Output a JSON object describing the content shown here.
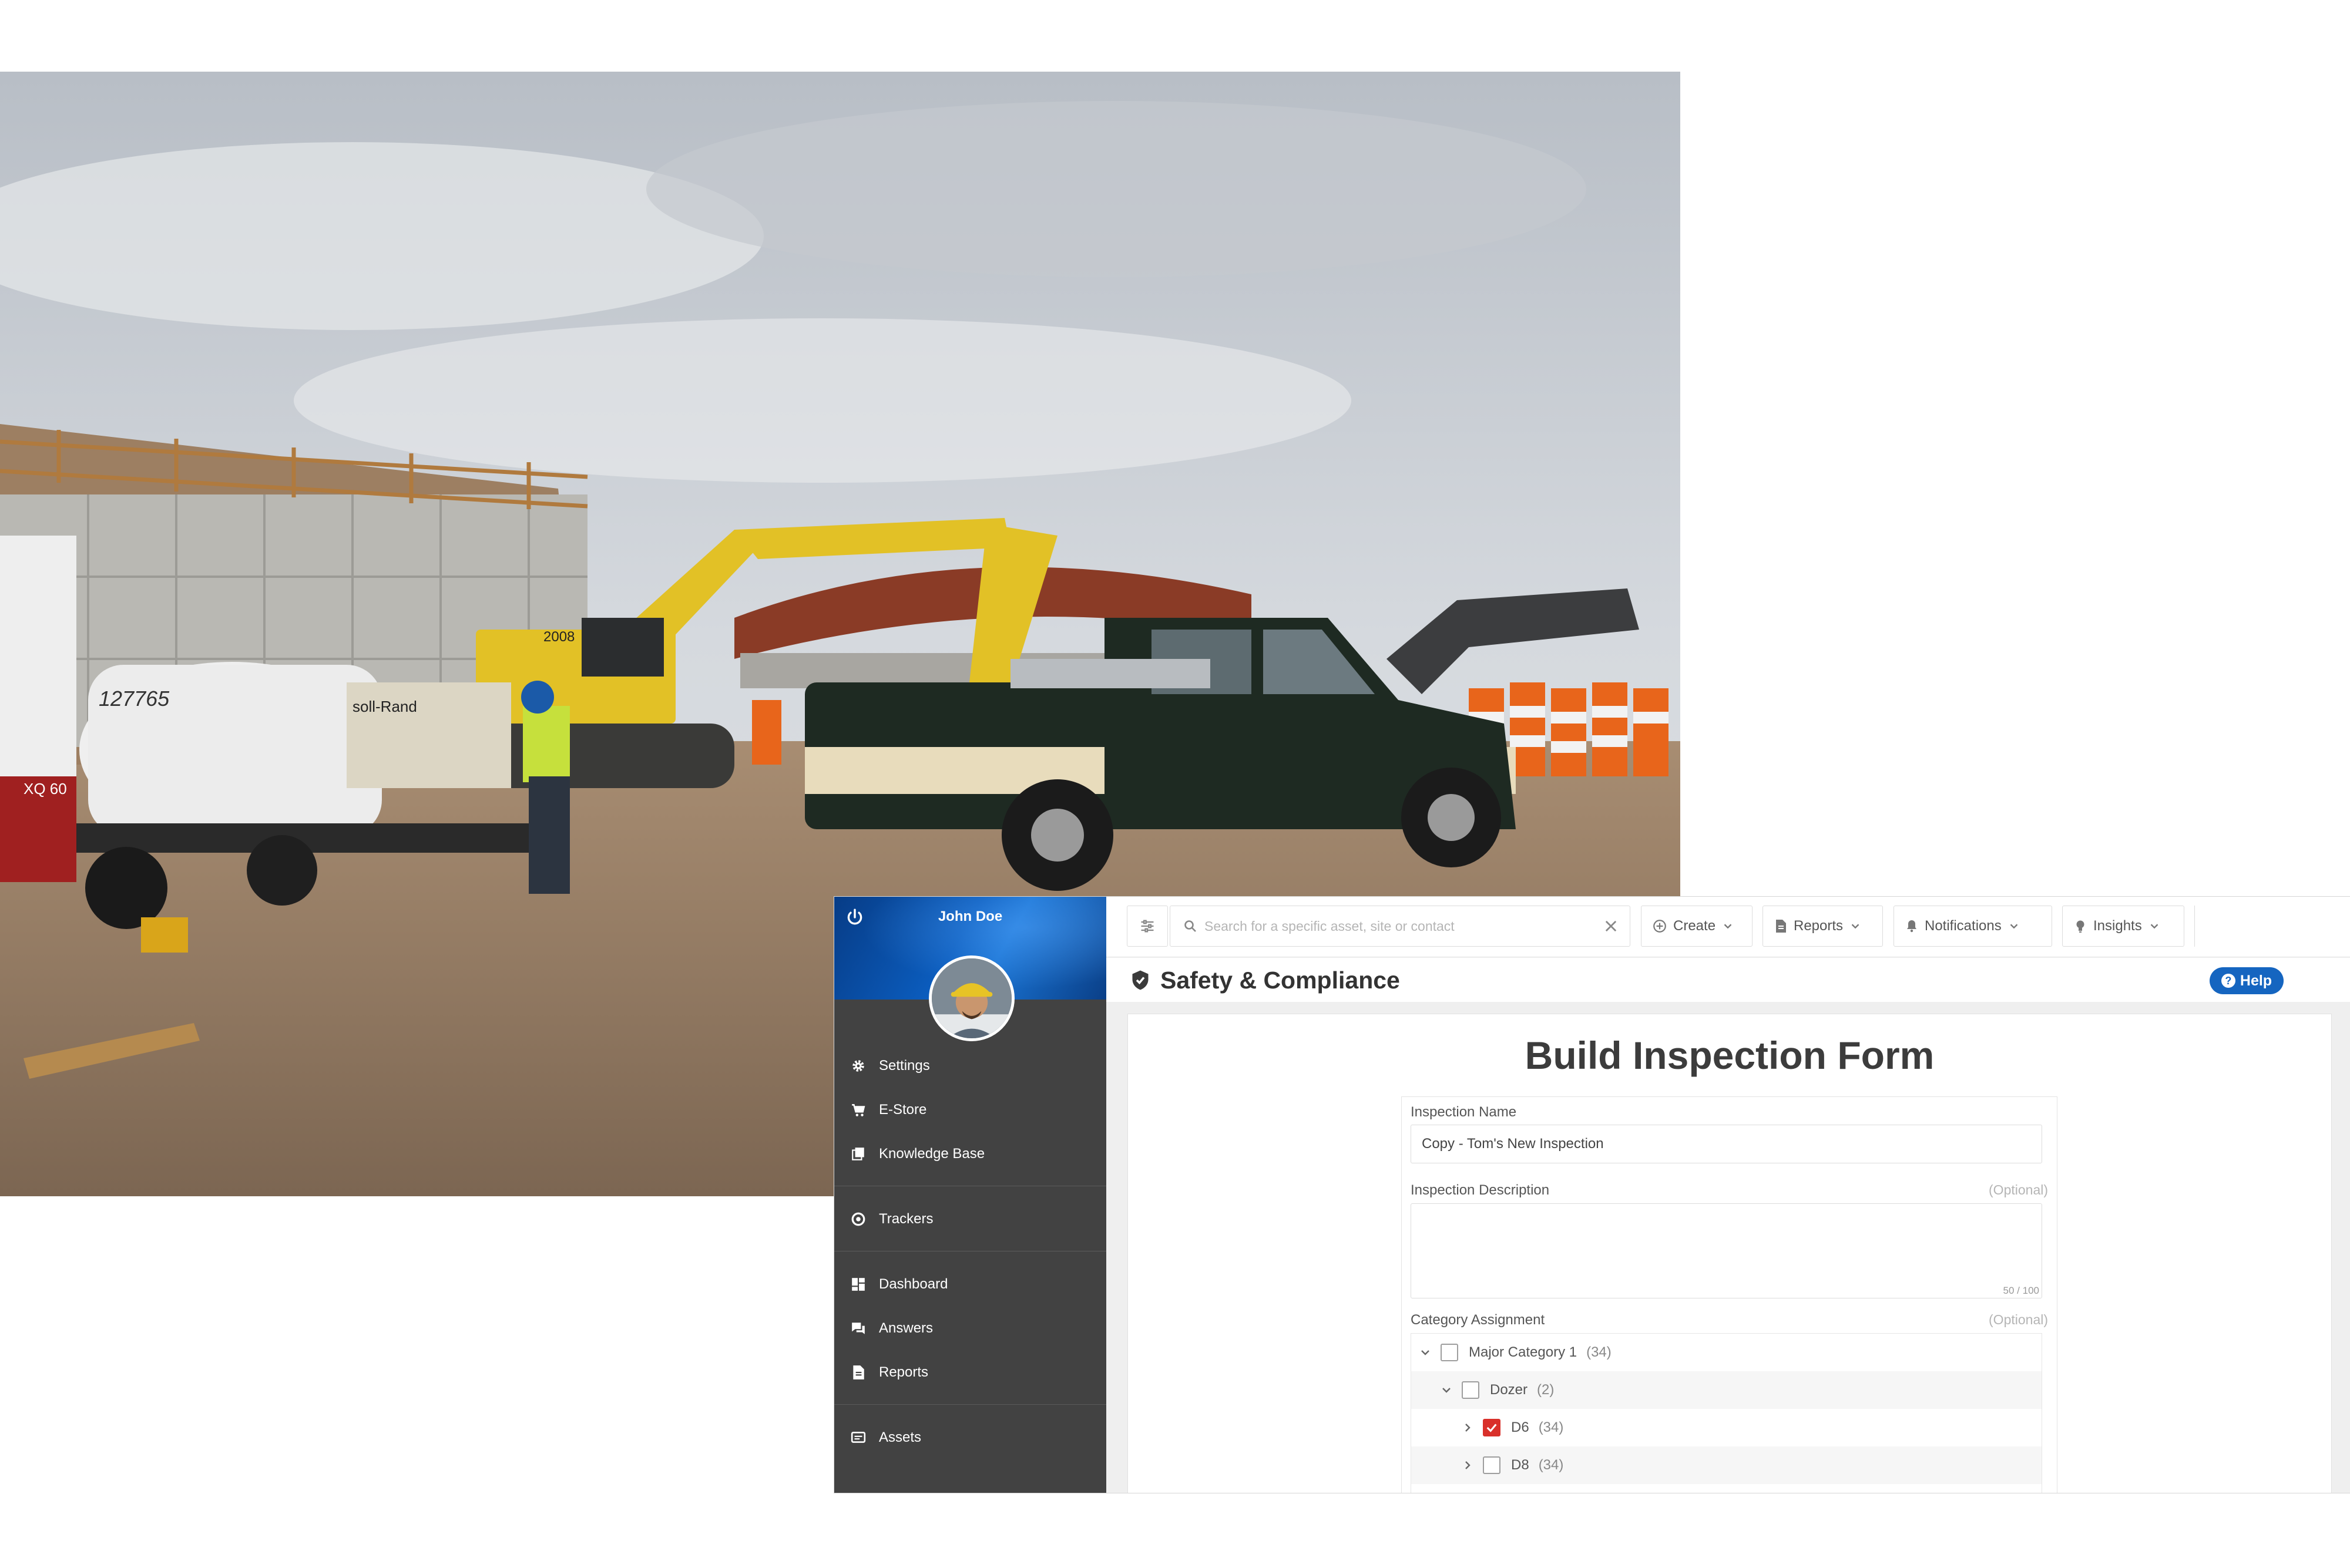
{
  "photo": {
    "description_icon": "construction-site-photo",
    "tank_number": "127765",
    "trailer_model": "XQ 60",
    "generator_brand": "soll-Rand",
    "excavator_number": "2008"
  },
  "app": {
    "user": {
      "name": "John Doe"
    },
    "sidebar": {
      "items": [
        {
          "label": "Settings",
          "icon": "gear-icon"
        },
        {
          "label": "E-Store",
          "icon": "cart-icon"
        },
        {
          "label": "Knowledge Base",
          "icon": "book-icon"
        },
        {
          "label": "Trackers",
          "icon": "target-icon"
        },
        {
          "label": "Dashboard",
          "icon": "dashboard-icon"
        },
        {
          "label": "Answers",
          "icon": "chat-icon"
        },
        {
          "label": "Reports",
          "icon": "report-icon"
        },
        {
          "label": "Assets",
          "icon": "assets-icon"
        }
      ]
    },
    "topbar": {
      "search_placeholder": "Search for a specific asset, site or contact",
      "create_label": "Create",
      "reports_label": "Reports",
      "notifications_label": "Notifications",
      "insights_label": "Insights"
    },
    "page_title": "Safety & Compliance",
    "help_label": "Help",
    "form": {
      "title": "Build Inspection Form",
      "name_label": "Inspection Name",
      "name_value": "Copy - Tom's New Inspection",
      "description_label": "Inspection Description",
      "description_optional": "(Optional)",
      "description_counter": "50 / 100",
      "category_label": "Category Assignment",
      "category_optional": "(Optional)",
      "categories": [
        {
          "label": "Major Category 1",
          "count": "(34)",
          "checked": false,
          "expanded": true
        },
        {
          "label": "Dozer",
          "count": "(2)",
          "checked": false,
          "expanded": true
        },
        {
          "label": "D6",
          "count": "(34)",
          "checked": true,
          "expanded": false
        },
        {
          "label": "D8",
          "count": "(34)",
          "checked": false,
          "expanded": false
        }
      ]
    },
    "colors": {
      "accent": "#1565c0",
      "checkbox_checked": "#d9302a",
      "sidebar": "#424242"
    }
  }
}
